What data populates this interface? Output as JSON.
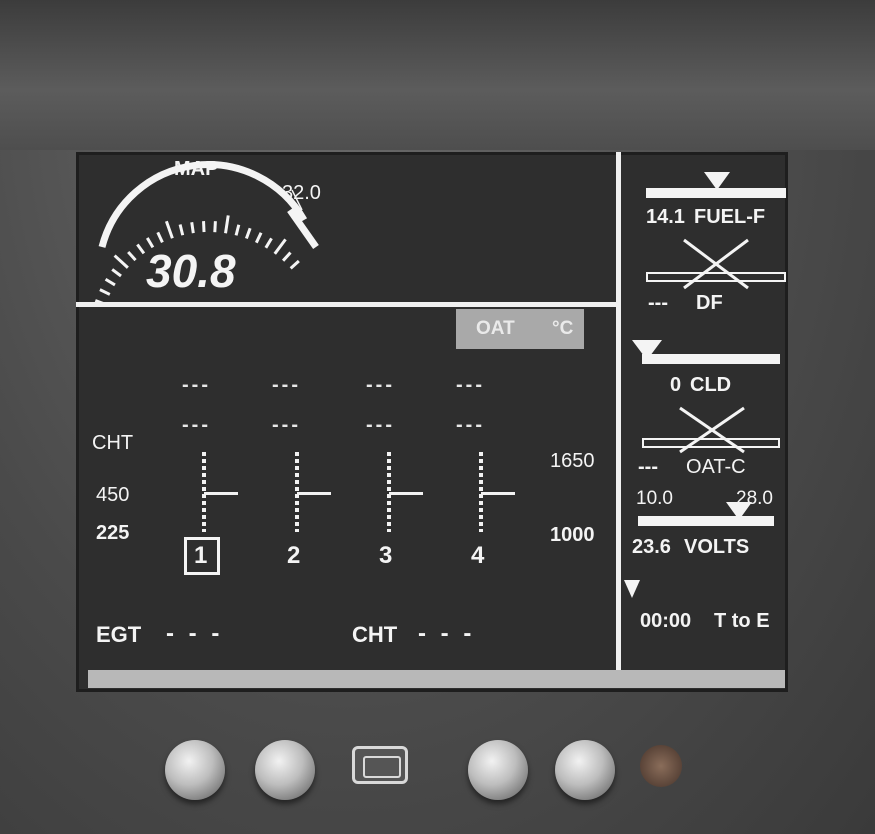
{
  "map": {
    "label": "MAP",
    "max_label": "32.0",
    "value": "30.8"
  },
  "oat_box": {
    "label": "OAT",
    "unit": "°C"
  },
  "cylinders": {
    "top_dashes": [
      "---",
      "---",
      "---",
      "---"
    ],
    "second_dashes": [
      "---",
      "---",
      "---",
      "---"
    ],
    "numbers": [
      "1",
      "2",
      "3",
      "4"
    ],
    "selected": "1"
  },
  "cht_scale": {
    "label": "CHT",
    "top": "450",
    "bottom": "225"
  },
  "egt_scale": {
    "top": "1650",
    "bottom": "1000"
  },
  "footer": {
    "egt_label": "EGT",
    "egt_value": "- - -",
    "cht_label": "CHT",
    "cht_value": "- - -"
  },
  "right_panel": {
    "fuel_flow": {
      "value": "14.1",
      "label": "FUEL-F",
      "level": 0.55
    },
    "df": {
      "value": "---",
      "label": "DF"
    },
    "cld": {
      "value": "0",
      "label": "CLD",
      "level": 0.0
    },
    "oat_c": {
      "value": "---",
      "label": "OAT-C"
    },
    "volts": {
      "min": "10.0",
      "max": "28.0",
      "value": "23.6",
      "label": "VOLTS"
    },
    "t_to_e": {
      "value": "00:00",
      "label": "T to E"
    }
  },
  "colors": {
    "screen_bg": "#2e2e2e",
    "foreground": "#f4f4f4",
    "bezel": "#4e4e4e"
  }
}
